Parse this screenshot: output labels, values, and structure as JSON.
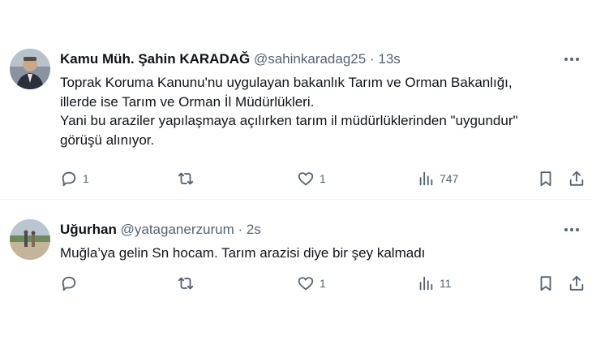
{
  "tweets": [
    {
      "author_name": "Kamu Müh. Şahin KARADAĞ",
      "handle": "@sahinkaradag25",
      "separator": "·",
      "time": "13s",
      "text_lines": [
        "Toprak Koruma Kanunu'nu uygulayan bakanlık Tarım ve Orman Bakanlığı,",
        "illerde ise Tarım ve Orman İl Müdürlükleri.",
        "Yani bu araziler yapılaşmaya açılırken tarım il müdürlüklerinden \"uygundur\"",
        "görüşü alınıyor."
      ],
      "reply_count": "1",
      "retweet_count": "",
      "like_count": "1",
      "view_count": "747",
      "icons": [
        "reply-icon",
        "retweet-icon",
        "like-icon",
        "views-icon",
        "bookmark-icon",
        "share-icon",
        "more-icon"
      ]
    },
    {
      "author_name": "Uğurhan",
      "handle": "@yataganerzurum",
      "separator": "·",
      "time": "2s",
      "text_lines": [
        "Muğla’ya gelin Sn hocam. Tarım arazisi diye bir şey kalmadı"
      ],
      "reply_count": "",
      "retweet_count": "",
      "like_count": "1",
      "view_count": "11",
      "icons": [
        "reply-icon",
        "retweet-icon",
        "like-icon",
        "views-icon",
        "bookmark-icon",
        "share-icon",
        "more-icon"
      ]
    }
  ],
  "colors": {
    "text": "#0f1419",
    "secondary": "#536471",
    "divider": "#eff3f4",
    "background": "#ffffff"
  }
}
